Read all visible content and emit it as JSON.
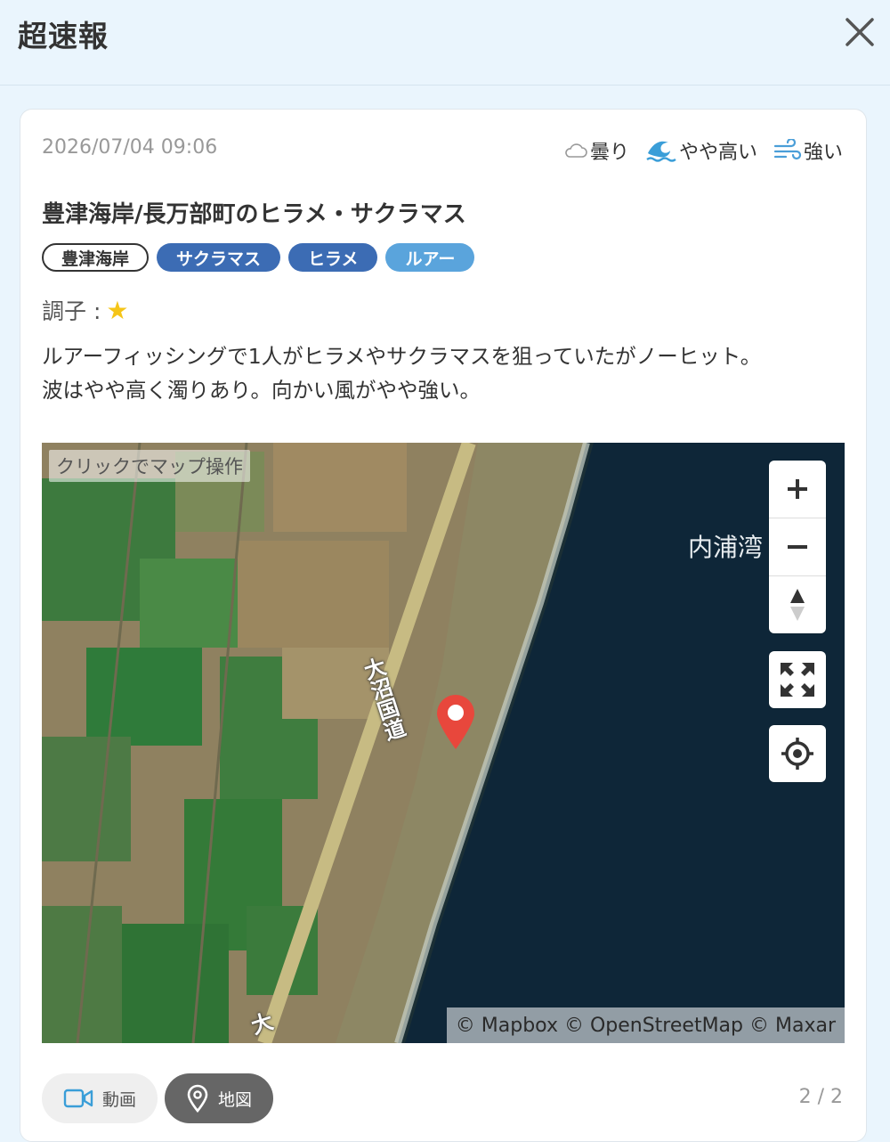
{
  "header": {
    "title": "超速報"
  },
  "report": {
    "date": "2026/07/04 09:06",
    "conditions": [
      {
        "icon": "cloud-icon",
        "label": "曇り"
      },
      {
        "icon": "wave-icon",
        "label": "やや高い"
      },
      {
        "icon": "wind-icon",
        "label": "強い"
      }
    ],
    "title": "豊津海岸/長万部町のヒラメ・サクラマス",
    "tags": [
      "豊津海岸",
      "サクラマス",
      "ヒラメ",
      "ルアー"
    ],
    "rating_label": "調子 :",
    "rating_star": "★",
    "body_line1": "ルアーフィッシングで1人がヒラメやサクラマスを狙っていたがノーヒット。",
    "body_line2": "波はやや高く濁りあり。向かい風がやや強い。"
  },
  "map": {
    "hint": "クリックでマップ操作",
    "bay_label": "内浦湾",
    "road_label": "大沼国道",
    "road_label_2": "大",
    "attribution": "© Mapbox © OpenStreetMap © Maxar",
    "marker_color": "#e8473c"
  },
  "footer": {
    "video_label": "動画",
    "map_label": "地図",
    "pager": "2 / 2"
  },
  "colors": {
    "tag_dark": "#3c6cb4",
    "tag_light": "#5aa4dc",
    "background": "#eaf5fd"
  }
}
